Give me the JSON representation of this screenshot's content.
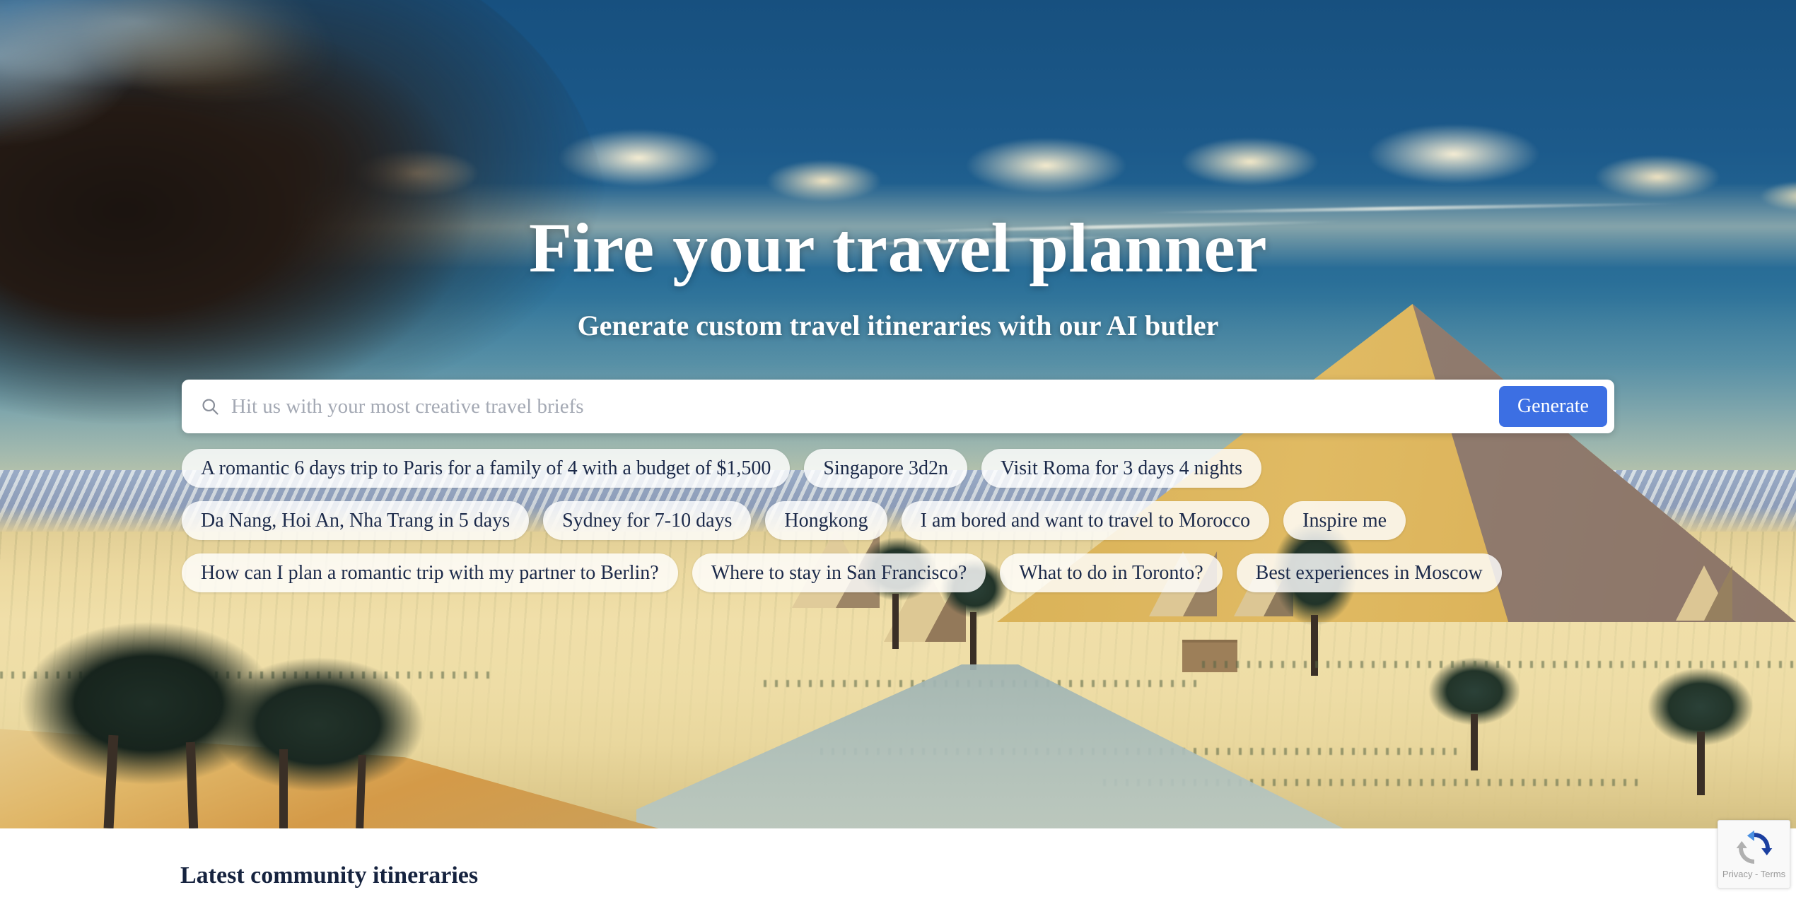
{
  "hero": {
    "title": "Fire your travel planner",
    "subtitle": "Generate custom travel itineraries with our AI butler",
    "background_alt": "Illustrated desert landscape with acacia trees, pyramids, snowy mountains and cumulus clouds"
  },
  "search": {
    "icon": "search-icon",
    "placeholder": "Hit us with your most creative travel briefs",
    "value": "",
    "generate_label": "Generate",
    "generate_color": "#3c6fe3"
  },
  "suggestions": [
    "A romantic 6 days trip to Paris for a family of 4 with a budget of $1,500",
    "Singapore 3d2n",
    "Visit Roma for 3 days 4 nights",
    "Da Nang, Hoi An, Nha Trang in 5 days",
    "Sydney for 7-10 days",
    "Hongkong",
    "I am bored and want to travel to Morocco",
    "Inspire me",
    "How can I plan a romantic trip with my partner to Berlin?",
    "Where to stay in San Francisco?",
    "What to do in Toronto?",
    "Best experiences in Moscow"
  ],
  "community": {
    "heading": "Latest community itineraries"
  },
  "recaptcha": {
    "logo": "recaptcha-logo-icon",
    "links": "Privacy - Terms"
  },
  "colors": {
    "accent": "#3c6fe3",
    "hero_text": "#ffffff",
    "chip_text": "#1c2a4a",
    "heading": "#16233f",
    "sky": "#1c5a8b",
    "sand": "#eedda6"
  }
}
